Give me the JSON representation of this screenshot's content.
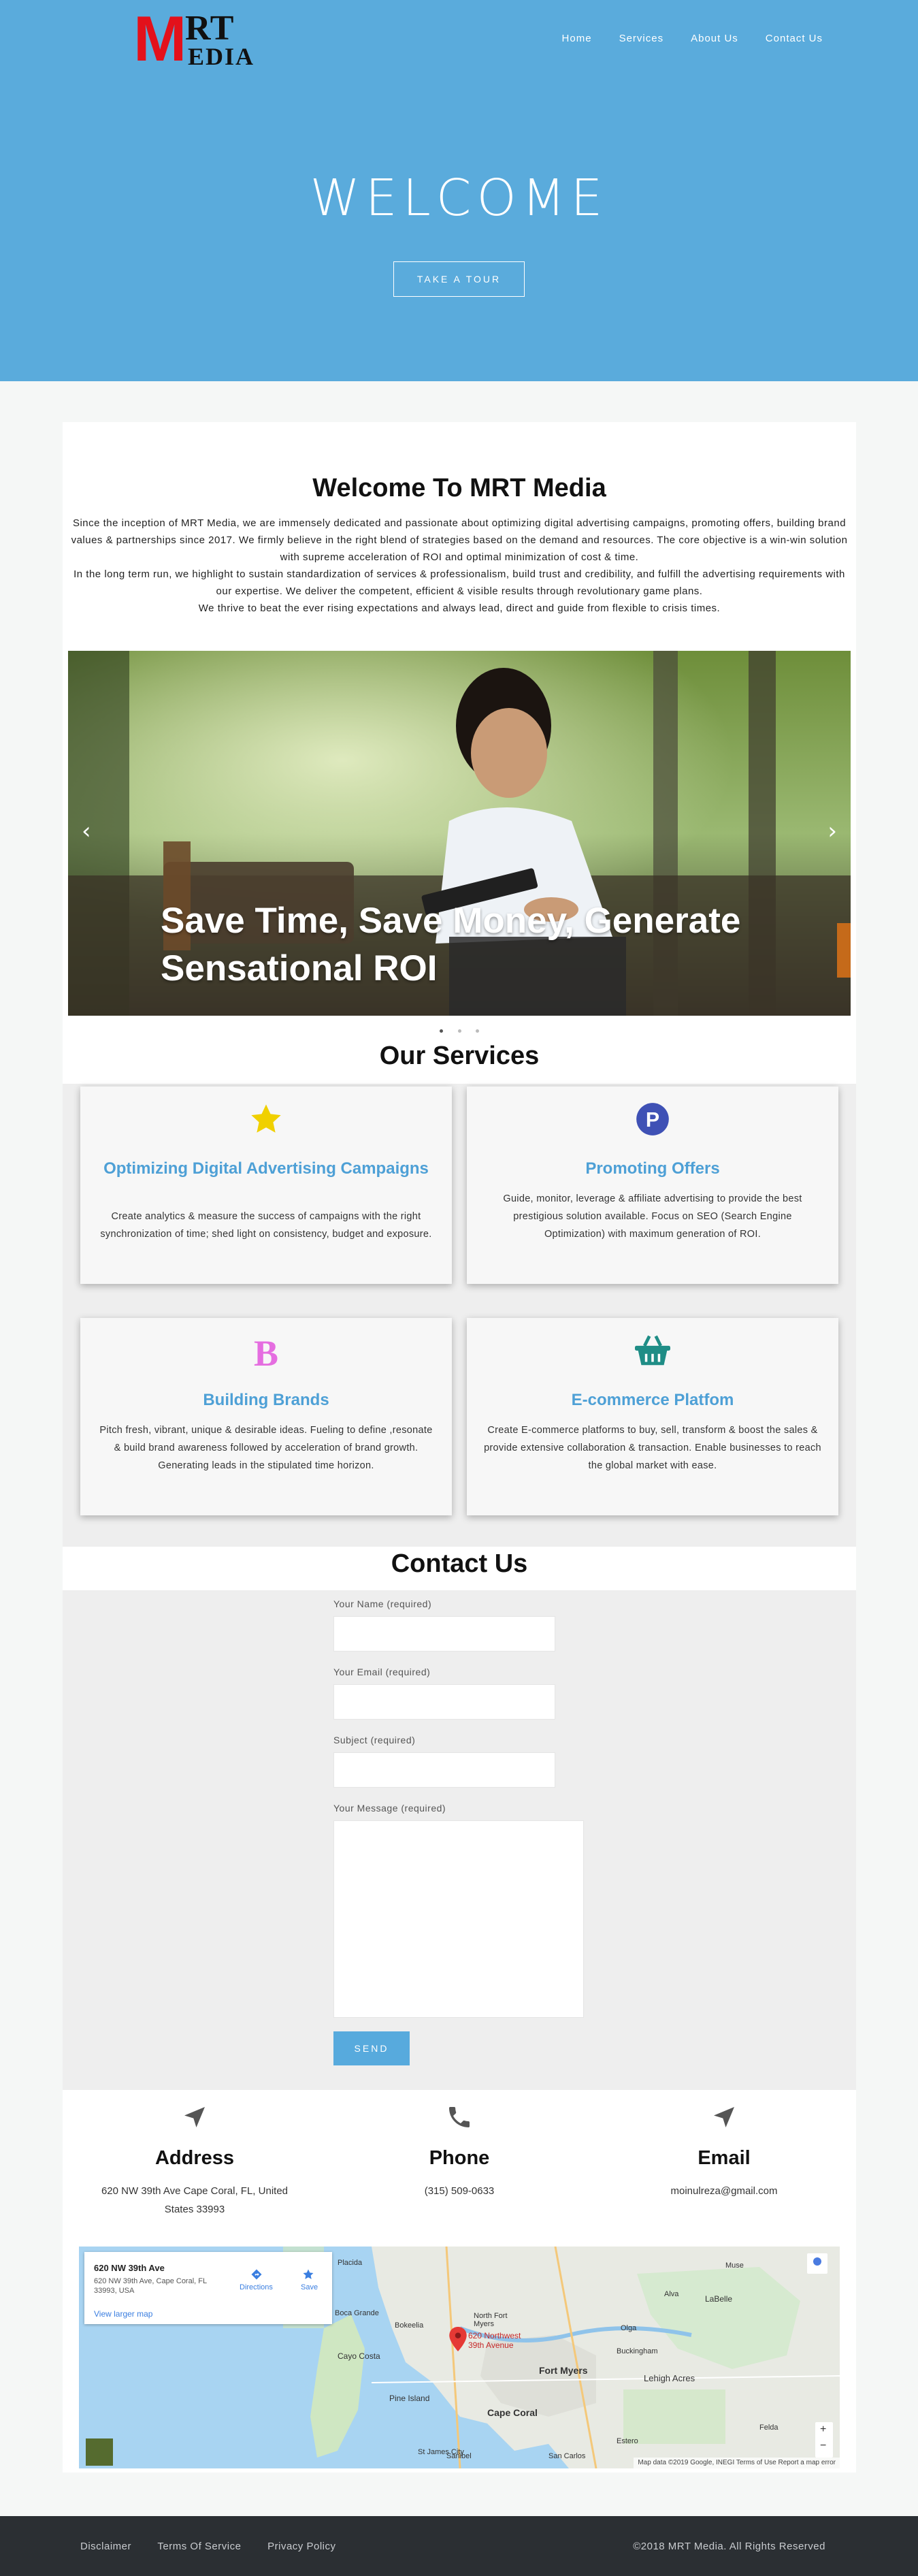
{
  "header": {
    "logo_letter": "M",
    "logo_rt": "RT",
    "logo_edia": "EDIA",
    "nav": [
      "Home",
      "Services",
      "About Us",
      "Contact Us"
    ]
  },
  "hero": {
    "title": "WELCOME",
    "button": "TAKE A TOUR"
  },
  "welcome": {
    "title": "Welcome To MRT Media",
    "paragraphs": [
      "Since the inception of MRT Media, we are immensely dedicated and passionate about optimizing digital advertising campaigns, promoting offers, building brand values & partnerships since 2017. We firmly believe in the right blend of strategies based on the demand and resources. The core objective is a win-win solution with supreme acceleration of ROI and optimal minimization of cost & time.",
      "In the long term run, we highlight to sustain standardization of services & professionalism, build trust and credibility, and fulfill the advertising requirements with our expertise. We deliver the competent, efficient & visible results through revolutionary game plans.",
      "We thrive to beat the ever rising expectations and always lead, direct and guide from flexible to crisis times."
    ]
  },
  "slider": {
    "caption": "Save Time, Save Money, Generate Sensational ROI",
    "prev": "‹",
    "next": "›"
  },
  "services": {
    "title": "Our Services",
    "items": [
      {
        "title": "Optimizing Digital Advertising Campaigns",
        "text": "Create analytics & measure the success of campaigns with the right synchronization of time; shed light on consistency, budget and exposure.",
        "icon": "star-icon",
        "color": "#f0d000"
      },
      {
        "title": "Promoting Offers",
        "text": "Guide, monitor, leverage & affiliate advertising to provide the best prestigious solution available. Focus on SEO (Search Engine Optimization) with maximum generation of ROI.",
        "icon": "parking-icon",
        "color": "#3f51b5"
      },
      {
        "title": "Building Brands",
        "text": "Pitch fresh, vibrant, unique & desirable ideas. Fueling to define ,resonate & build brand awareness followed by acceleration of brand growth. Generating leads in the stipulated time horizon.",
        "icon": "b-letter-icon",
        "color": "#e56ee0",
        "glyph": "B"
      },
      {
        "title": "E-commerce Platfom",
        "text": "Create E-commerce platforms to buy, sell, transform & boost the sales & provide extensive collaboration & transaction. Enable businesses to reach the global market with ease.",
        "icon": "basket-icon",
        "color": "#1f8d86"
      }
    ]
  },
  "contact": {
    "title": "Contact Us",
    "labels": {
      "name": "Your Name (required)",
      "email": "Your Email (required)",
      "subject": "Subject (required)",
      "message": "Your Message (required)"
    },
    "send": "SEND",
    "info": [
      {
        "title": "Address",
        "text": "620 NW 39th Ave Cape Coral, FL, United States 33993",
        "icon": "navigation-arrow-icon"
      },
      {
        "title": "Phone",
        "text": "(315) 509-0633",
        "icon": "phone-icon"
      },
      {
        "title": "Email",
        "text": "moinulreza@gmail.com",
        "icon": "navigation-arrow-icon"
      }
    ]
  },
  "map": {
    "place_title": "620 NW 39th Ave",
    "place_address": "620 NW 39th Ave, Cape Coral, FL 33993, USA",
    "directions": "Directions",
    "save": "Save",
    "larger": "View larger map",
    "pin_label": "620 Northwest 39th Avenue",
    "towns": [
      "Fort Myers",
      "Cape Coral",
      "Lehigh Acres",
      "North Fort Myers",
      "Pine Island",
      "Cayo Costa",
      "Sanibel",
      "San Carlos",
      "Estero",
      "Felda",
      "LaBelle",
      "Muse",
      "Alva",
      "Olga",
      "Buckingham",
      "Placida",
      "Boca Grande",
      "Bokeelia",
      "St James City"
    ],
    "footer": "Map data ©2019 Google, INEGI   Terms of Use   Report a map error",
    "zoom_in": "+",
    "zoom_out": "−"
  },
  "footer": {
    "links": [
      "Disclaimer",
      "Terms Of Service",
      "Privacy Policy"
    ],
    "copyright": "©2018 MRT Media. All Rights Reserved"
  }
}
